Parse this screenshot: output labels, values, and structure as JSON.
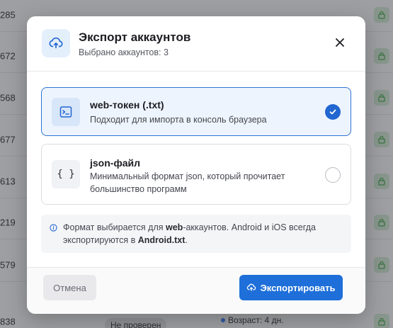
{
  "background": {
    "row_ids": [
      "285",
      "672",
      "568",
      "677",
      "613",
      "219",
      "579",
      "838"
    ],
    "status_badge": "Не проверен",
    "age_label": "Возраст: 4 дн."
  },
  "modal": {
    "title": "Экспорт аккаунтов",
    "subtitle": "Выбрано аккаунтов: 3",
    "options": [
      {
        "title": "web-токен (.txt)",
        "description": "Подходит для импорта в консоль браузера",
        "icon": "terminal-icon",
        "selected": true
      },
      {
        "title": "json-файл",
        "description": "Минимальный формат json, который прочитает большинство программ",
        "icon": "braces-icon",
        "icon_glyph": "{ }",
        "selected": false
      }
    ],
    "info": {
      "part1": "Формат выбирается для ",
      "bold1": "web",
      "part2": "-аккаунтов. Android и iOS всегда экспортируются в ",
      "bold2": "Android.txt",
      "part3": "."
    },
    "cancel_label": "Отмена",
    "export_label": "Экспортировать"
  },
  "colors": {
    "accent": "#1e6fd9",
    "selected_bg": "#eef4fd",
    "lock_bg": "#d7efd9"
  }
}
